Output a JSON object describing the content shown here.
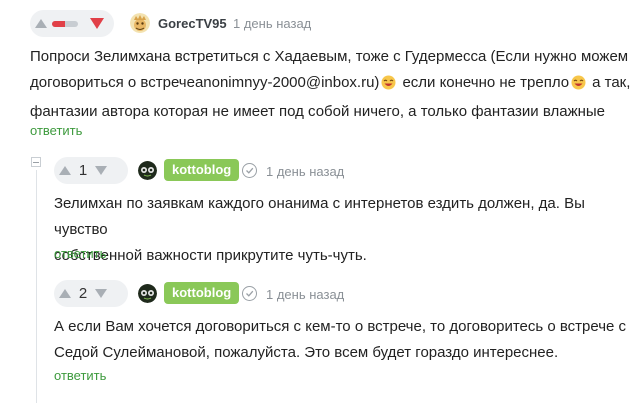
{
  "comment1": {
    "author": "GorecTV95",
    "time": "1 день назад",
    "rating_fraction": 0.5,
    "line1": "Попроси Зелимхана встретиться с Хадаевым, тоже с Гудермесса (Если нужно можем",
    "line2a": "договориться о встречеanonimnyy-2000@inbox.ru)",
    "line2b": "если конечно не трепло",
    "line2c": "а так,",
    "line3": "фантазии автора которая не имеет под собой ничего, а только фантазии влажные",
    "reply": "ответить"
  },
  "comment2": {
    "score": "1",
    "author": "kottoblog",
    "time": "1 день назад",
    "line1": "Зелимхан по заявкам каждого онанима с интернетов ездить должен, да. Вы чувство",
    "line2": "собственной важности прикрутите чуть-чуть.",
    "reply": "ответить"
  },
  "comment3": {
    "score": "2",
    "author": "kottoblog",
    "time": "1 день назад",
    "line1": "А если Вам хочется договориться с кем-то о встрече, то договоритесь о встрече с",
    "line2": "Седой Сулеймановой, пожалуйста. Это всем будет гораздо интереснее.",
    "reply": "ответить"
  },
  "colors": {
    "badge": "#8ac858",
    "reply": "#3d9a3d",
    "downvote": "#e14048"
  }
}
